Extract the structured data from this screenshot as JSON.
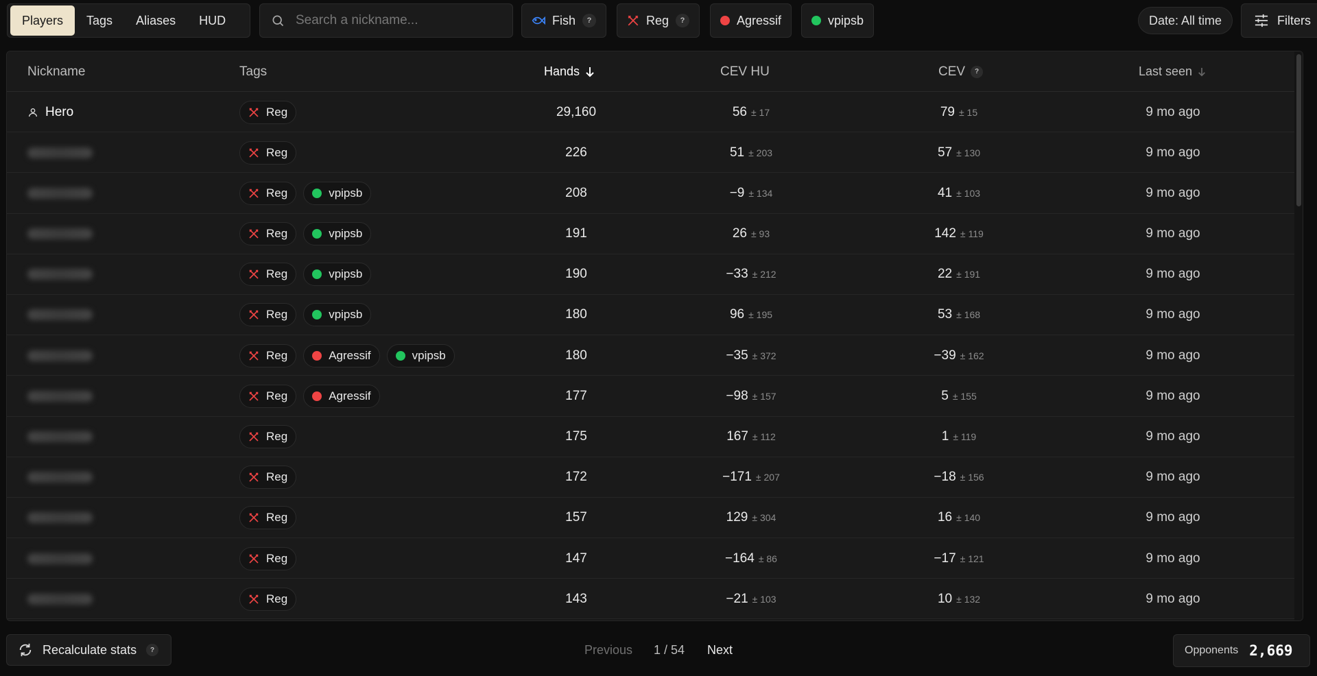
{
  "nav": {
    "tabs": [
      {
        "label": "Players",
        "active": true
      },
      {
        "label": "Tags"
      },
      {
        "label": "Aliases"
      },
      {
        "label": "HUD"
      }
    ]
  },
  "search": {
    "placeholder": "Search a nickname...",
    "value": ""
  },
  "chips": {
    "fish": {
      "label": "Fish",
      "help": "?"
    },
    "reg": {
      "label": "Reg",
      "help": "?"
    },
    "agressif": {
      "label": "Agressif"
    },
    "vpipsb": {
      "label": "vpipsb"
    }
  },
  "date_filter": "Date: All time",
  "filters_label": "Filters",
  "table": {
    "headers": {
      "nickname": "Nickname",
      "tags": "Tags",
      "hands": "Hands",
      "cev_hu": "CEV HU",
      "cev": "CEV",
      "cev_help": "?",
      "last_seen": "Last seen"
    },
    "rows": [
      {
        "nickname": "Hero",
        "tags": [
          "Reg"
        ],
        "hands": "29,160",
        "cev_hu": "56",
        "cev_hu_pm": "± 17",
        "cev": "79",
        "cev_pm": "± 15",
        "last_seen": "9 mo ago"
      },
      {
        "nickname": "",
        "tags": [
          "Reg"
        ],
        "hands": "226",
        "cev_hu": "51",
        "cev_hu_pm": "± 203",
        "cev": "57",
        "cev_pm": "± 130",
        "last_seen": "9 mo ago"
      },
      {
        "nickname": "",
        "tags": [
          "Reg",
          "vpipsb"
        ],
        "hands": "208",
        "cev_hu": "−9",
        "cev_hu_pm": "± 134",
        "cev": "41",
        "cev_pm": "± 103",
        "last_seen": "9 mo ago"
      },
      {
        "nickname": "",
        "tags": [
          "Reg",
          "vpipsb"
        ],
        "hands": "191",
        "cev_hu": "26",
        "cev_hu_pm": "± 93",
        "cev": "142",
        "cev_pm": "± 119",
        "last_seen": "9 mo ago"
      },
      {
        "nickname": "",
        "tags": [
          "Reg",
          "vpipsb"
        ],
        "hands": "190",
        "cev_hu": "−33",
        "cev_hu_pm": "± 212",
        "cev": "22",
        "cev_pm": "± 191",
        "last_seen": "9 mo ago"
      },
      {
        "nickname": "",
        "tags": [
          "Reg",
          "vpipsb"
        ],
        "hands": "180",
        "cev_hu": "96",
        "cev_hu_pm": "± 195",
        "cev": "53",
        "cev_pm": "± 168",
        "last_seen": "9 mo ago"
      },
      {
        "nickname": "",
        "tags": [
          "Reg",
          "Agressif",
          "vpipsb"
        ],
        "hands": "180",
        "cev_hu": "−35",
        "cev_hu_pm": "± 372",
        "cev": "−39",
        "cev_pm": "± 162",
        "last_seen": "9 mo ago"
      },
      {
        "nickname": "",
        "tags": [
          "Reg",
          "Agressif"
        ],
        "hands": "177",
        "cev_hu": "−98",
        "cev_hu_pm": "± 157",
        "cev": "5",
        "cev_pm": "± 155",
        "last_seen": "9 mo ago"
      },
      {
        "nickname": "",
        "tags": [
          "Reg"
        ],
        "hands": "175",
        "cev_hu": "167",
        "cev_hu_pm": "± 112",
        "cev": "1",
        "cev_pm": "± 119",
        "last_seen": "9 mo ago"
      },
      {
        "nickname": "",
        "tags": [
          "Reg"
        ],
        "hands": "172",
        "cev_hu": "−171",
        "cev_hu_pm": "± 207",
        "cev": "−18",
        "cev_pm": "± 156",
        "last_seen": "9 mo ago"
      },
      {
        "nickname": "",
        "tags": [
          "Reg"
        ],
        "hands": "157",
        "cev_hu": "129",
        "cev_hu_pm": "± 304",
        "cev": "16",
        "cev_pm": "± 140",
        "last_seen": "9 mo ago"
      },
      {
        "nickname": "",
        "tags": [
          "Reg"
        ],
        "hands": "147",
        "cev_hu": "−164",
        "cev_hu_pm": "± 86",
        "cev": "−17",
        "cev_pm": "± 121",
        "last_seen": "9 mo ago"
      },
      {
        "nickname": "",
        "tags": [
          "Reg"
        ],
        "hands": "143",
        "cev_hu": "−21",
        "cev_hu_pm": "± 103",
        "cev": "10",
        "cev_pm": "± 132",
        "last_seen": "9 mo ago"
      }
    ]
  },
  "footer": {
    "recalculate": "Recalculate stats",
    "recalculate_help": "?",
    "previous": "Previous",
    "page": "1 / 54",
    "next": "Next",
    "opponents_label": "Opponents",
    "opponents_value": "2,669"
  },
  "colors": {
    "accent_tab": "#ede3cb",
    "red": "#ef4444",
    "green": "#22c55e",
    "fish_blue": "#3b82f6",
    "reg_icon": "#ef4444"
  }
}
